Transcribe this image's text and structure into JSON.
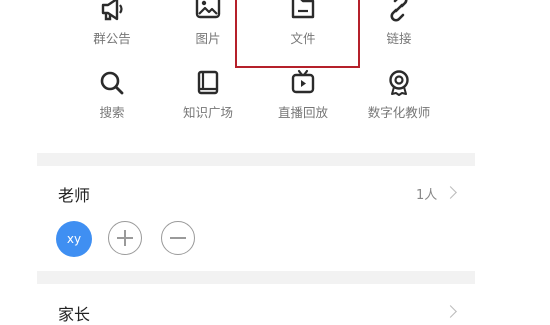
{
  "grid": {
    "row1": [
      {
        "label": "群公告",
        "icon": "megaphone-icon"
      },
      {
        "label": "图片",
        "icon": "image-icon"
      },
      {
        "label": "文件",
        "icon": "folder-icon"
      },
      {
        "label": "链接",
        "icon": "link-icon"
      }
    ],
    "row2": [
      {
        "label": "搜索",
        "icon": "search-icon"
      },
      {
        "label": "知识广场",
        "icon": "book-icon"
      },
      {
        "label": "直播回放",
        "icon": "tv-icon"
      },
      {
        "label": "数字化教师",
        "icon": "badge-icon"
      }
    ]
  },
  "teachers": {
    "title": "老师",
    "count": "1人",
    "avatar_text": "xy"
  },
  "parents": {
    "title": "家长"
  },
  "colors": {
    "accent": "#3f8ff2",
    "highlight": "#b5202a",
    "icon": "#2b2b2b"
  }
}
